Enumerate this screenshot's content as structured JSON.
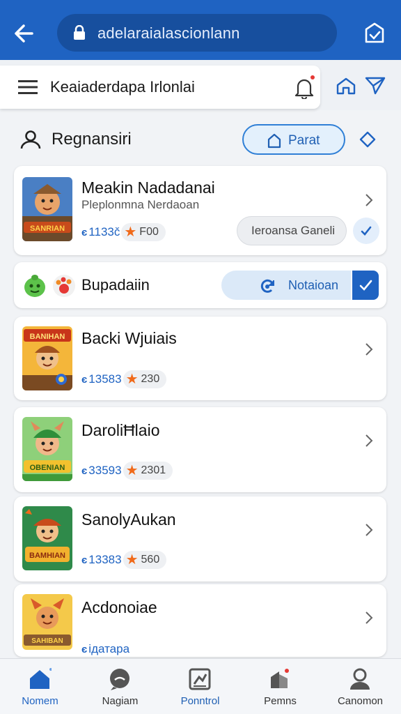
{
  "browser": {
    "url": "adelaraialascionlann"
  },
  "subbar": {
    "title": "Keaiaderdapa Irlonlai"
  },
  "section": {
    "title": "Regnansiri",
    "action_label": "Parat"
  },
  "cards": [
    {
      "title": "Meakin Nadadanai",
      "subtitle": "Pleplonmna Nerdaoan",
      "id": "1133č",
      "rating": "F00",
      "tag": "Ieroansa Ganeli",
      "thumb_text": "SANRIAN",
      "thumb_color": "#c84b1b"
    },
    {
      "title": "Backi Wjuiais",
      "id": "13583",
      "rating": "230",
      "thumb_text": "BANIHAN",
      "thumb_color": "#e08a1a"
    },
    {
      "title": "DaroliĦlaio",
      "id": "33593",
      "rating": "2301",
      "thumb_text": "OBENIAN",
      "thumb_color": "#3f9a3a"
    },
    {
      "title": "SanolyAukan",
      "id": "13383",
      "rating": "560",
      "thumb_text": "BAMHIAN",
      "thumb_color": "#2e8b4a"
    },
    {
      "title": "Acdonoiae",
      "id": "ідатара",
      "thumb_text": "SAHIBAN",
      "thumb_color": "#d95a2a"
    }
  ],
  "action_row": {
    "title": "Bupadaiin",
    "button_label": "Notaioan"
  },
  "nav": {
    "items": [
      {
        "label": "Nomem",
        "icon": "home-icon"
      },
      {
        "label": "Nagiam",
        "icon": "chat-icon"
      },
      {
        "label": "Ponntrol",
        "icon": "control-icon"
      },
      {
        "label": "Pemns",
        "icon": "parcel-icon"
      },
      {
        "label": "Canomon",
        "icon": "profile-icon"
      }
    ]
  },
  "colors": {
    "primary": "#1f63c2",
    "accent_orange": "#f06a1a",
    "background": "#f1f3f6"
  }
}
